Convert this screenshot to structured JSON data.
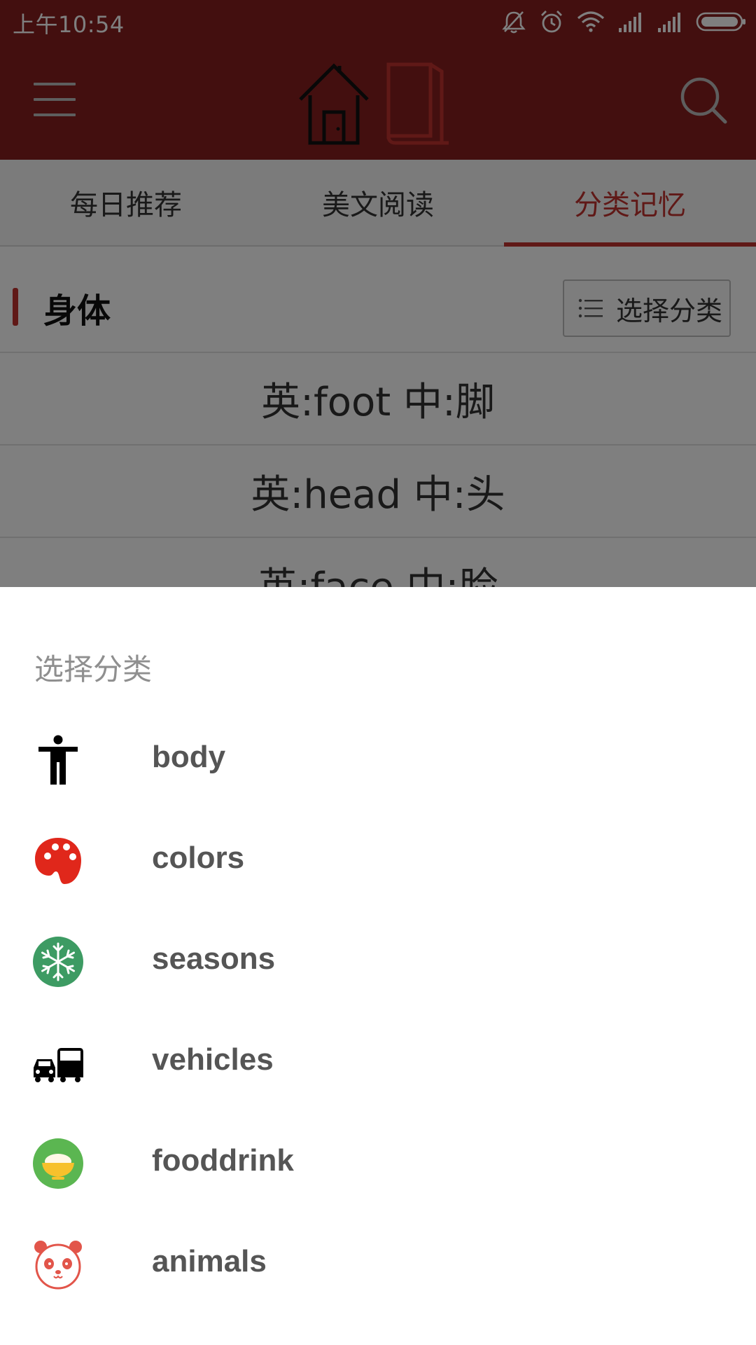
{
  "status_bar": {
    "time": "上午10:54",
    "icons": [
      "mute-icon",
      "alarm-icon",
      "wifi-icon",
      "signal-icon",
      "signal-icon",
      "battery-icon"
    ]
  },
  "app_bar": {
    "color": "#871f1f",
    "menu_icon": "menu-icon",
    "logo_icons": [
      "home-icon",
      "book-icon"
    ],
    "search_icon": "search-icon"
  },
  "tabs": [
    {
      "label": "每日推荐",
      "active": false
    },
    {
      "label": "美文阅读",
      "active": false
    },
    {
      "label": "分类记忆",
      "active": true
    }
  ],
  "category": {
    "title": "身体",
    "choose_button_label": "选择分类"
  },
  "words": [
    {
      "text": "英:foot 中:脚"
    },
    {
      "text": "英:head 中:头"
    },
    {
      "text": "英:face 中:脸"
    }
  ],
  "sheet": {
    "title": "选择分类",
    "items": [
      {
        "label": "body",
        "icon": "person-icon"
      },
      {
        "label": "colors",
        "icon": "palette-icon"
      },
      {
        "label": "seasons",
        "icon": "snowflake-icon"
      },
      {
        "label": "vehicles",
        "icon": "car-bus-icon"
      },
      {
        "label": "fooddrink",
        "icon": "rice-bowl-icon"
      },
      {
        "label": "animals",
        "icon": "panda-icon"
      }
    ]
  },
  "colors": {
    "accent": "#c0322f",
    "brand": "#871f1f"
  }
}
